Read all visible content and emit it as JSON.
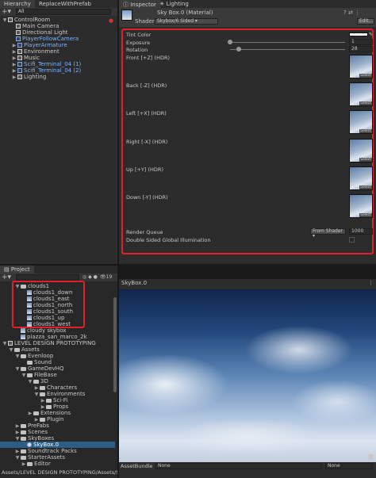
{
  "hierarchy": {
    "tabs": [
      "Hierarchy",
      "ReplaceWithPrefab"
    ],
    "search_text": "All",
    "items": [
      {
        "label": "ControlRoom",
        "blue": false
      },
      {
        "label": "Main Camera",
        "blue": false
      },
      {
        "label": "Directional Light",
        "blue": false
      },
      {
        "label": "PlayerFollowCamera",
        "blue": true
      },
      {
        "label": "PlayerArmature",
        "blue": true
      },
      {
        "label": "Environment",
        "blue": false
      },
      {
        "label": "Music",
        "blue": false
      },
      {
        "label": "Scifi_Terminal_04 (1)",
        "blue": true
      },
      {
        "label": "Scifi_Terminal_04 (2)",
        "blue": true
      },
      {
        "label": "Lighting",
        "blue": false
      }
    ]
  },
  "inspector": {
    "tabs": [
      "Inspector",
      "Lighting"
    ],
    "material_name": "Sky Box.0 (Material)",
    "shader_label": "Shader",
    "shader_value": "Skybox/6 Sided",
    "edit_button": "Edit...",
    "properties": {
      "tint": "Tint Color",
      "exposure_label": "Exposure",
      "exposure_value": "1",
      "rotation_label": "Rotation",
      "rotation_value": "28",
      "front": "Front [+Z]   (HDR)",
      "back": "Back [-Z]   (HDR)",
      "left": "Left [+X]   (HDR)",
      "right": "Right [-X]   (HDR)",
      "up": "Up [+Y]   (HDR)",
      "down": "Down [-Y]   (HDR)",
      "render_queue_label": "Render Queue",
      "render_queue_mode": "From Shader",
      "render_queue_value": "1000",
      "double_sided": "Double Sided Global Illumination"
    },
    "select_label": "Select"
  },
  "project": {
    "tab": "Project",
    "count": "19",
    "items": [
      {
        "label": "clouds1",
        "type": "folder"
      },
      {
        "label": "clouds1_down",
        "type": "thumb"
      },
      {
        "label": "clouds1_east",
        "type": "thumb"
      },
      {
        "label": "clouds1_north",
        "type": "thumb"
      },
      {
        "label": "clouds1_south",
        "type": "thumb"
      },
      {
        "label": "clouds1_up",
        "type": "thumb"
      },
      {
        "label": "clouds1_west",
        "type": "thumb"
      },
      {
        "label": "cloudy skybox",
        "type": "thumb"
      },
      {
        "label": "piazza_san_marco_2k",
        "type": "thumb"
      },
      {
        "label": "LEVEL DESIGN PROTOTYPING",
        "type": "cube"
      },
      {
        "label": "Assets",
        "type": "folder"
      },
      {
        "label": "Evenloop",
        "type": "folder"
      },
      {
        "label": "Sound",
        "type": "folder"
      },
      {
        "label": "GameDevHQ",
        "type": "folder"
      },
      {
        "label": "FileBase",
        "type": "folder"
      },
      {
        "label": "3D",
        "type": "folder"
      },
      {
        "label": "Characters",
        "type": "folder"
      },
      {
        "label": "Environments",
        "type": "folder"
      },
      {
        "label": "Sci-Fi",
        "type": "folder"
      },
      {
        "label": "Props",
        "type": "folder"
      },
      {
        "label": "Extensions",
        "type": "folder"
      },
      {
        "label": "Plugin",
        "type": "folder"
      },
      {
        "label": "PreFabs",
        "type": "folder"
      },
      {
        "label": "Scenes",
        "type": "folder"
      },
      {
        "label": "SkyBoxes",
        "type": "folder"
      },
      {
        "label": "SkyBox.0",
        "type": "material"
      },
      {
        "label": "Soundtrack Packs",
        "type": "folder"
      },
      {
        "label": "StarterAssets",
        "type": "folder"
      },
      {
        "label": "Editor",
        "type": "folder"
      }
    ],
    "path": "Assets/LEVEL DESIGN PROTOTYPING/Assets/SkyB"
  },
  "preview": {
    "title": "SkyBox.0",
    "assetbundle_label": "AssetBundle",
    "bundle_value": "None",
    "variant_value": "None"
  }
}
